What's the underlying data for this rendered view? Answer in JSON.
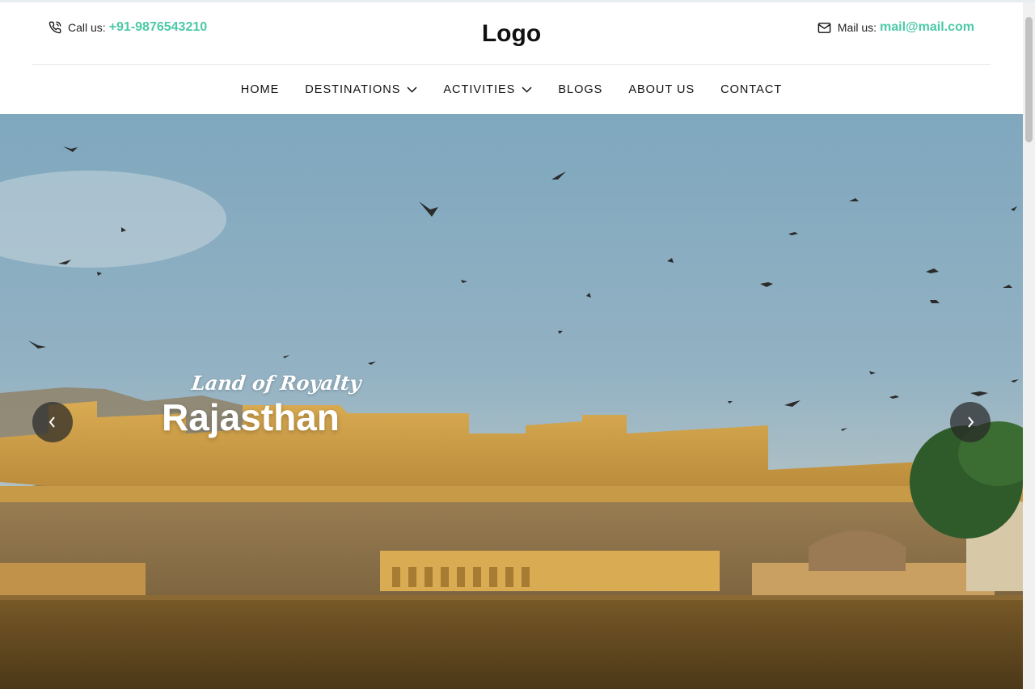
{
  "header": {
    "call_label": "Call us:",
    "phone": "+91-9876543210",
    "logo": "Logo",
    "mail_label": "Mail us:",
    "email": "mail@mail.com",
    "accent_color": "#4cc9a6",
    "icons": {
      "call": "phone-icon",
      "mail": "mail-icon"
    }
  },
  "nav": {
    "items": [
      {
        "label": "HOME",
        "has_dropdown": false
      },
      {
        "label": "DESTINATIONS",
        "has_dropdown": true
      },
      {
        "label": "ACTIVITIES",
        "has_dropdown": true
      },
      {
        "label": "BLOGS",
        "has_dropdown": false
      },
      {
        "label": "ABOUT US",
        "has_dropdown": false
      },
      {
        "label": "CONTACT",
        "has_dropdown": false
      }
    ]
  },
  "hero": {
    "tagline": "Land of Royalty",
    "title": "Rajasthan",
    "icons": {
      "prev": "chevron-left-icon",
      "next": "chevron-right-icon"
    }
  }
}
